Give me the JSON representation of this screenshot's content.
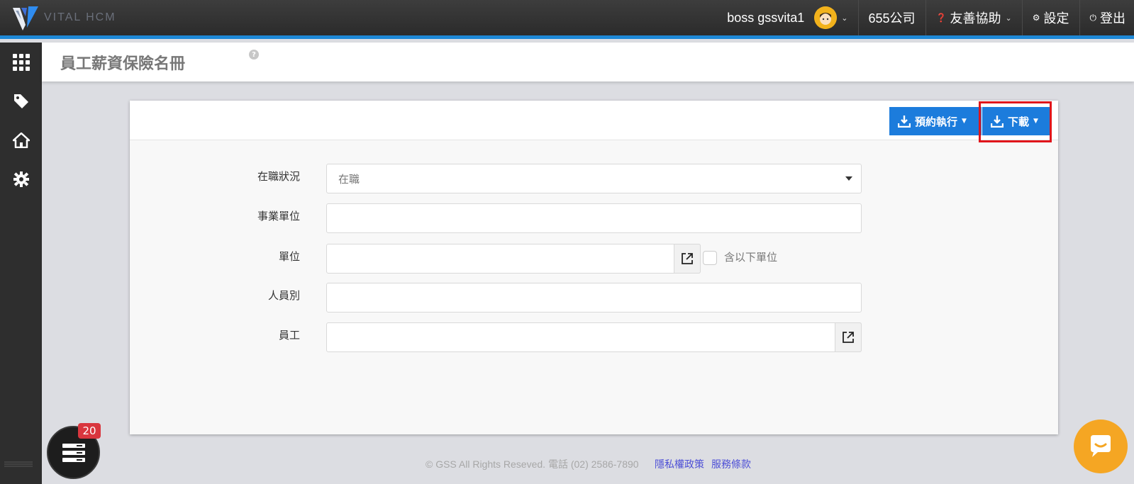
{
  "app": {
    "brand": "VITAL HCM"
  },
  "header": {
    "user_name": "boss gssvita1",
    "company": "655公司",
    "help_label": "友善協助",
    "settings_label": "設定",
    "logout_label": "登出"
  },
  "sidebar": {
    "items": [
      {
        "name": "apps-grid-icon"
      },
      {
        "name": "tag-icon"
      },
      {
        "name": "home-icon"
      },
      {
        "name": "gear-icon"
      }
    ]
  },
  "page": {
    "title": "員工薪資保險名冊",
    "help": "?"
  },
  "toolbar": {
    "schedule_label": "預約執行",
    "download_label": "下載"
  },
  "form": {
    "employment_status": {
      "label": "在職狀況",
      "value": "在職"
    },
    "business_unit": {
      "label": "事業單位",
      "value": ""
    },
    "unit": {
      "label": "單位",
      "value": "",
      "include_sub_label": "含以下單位"
    },
    "staff_type": {
      "label": "人員別",
      "value": ""
    },
    "employee": {
      "label": "員工",
      "value": ""
    }
  },
  "footer": {
    "copyright": "© GSS All Rights Reseved. 電話 (02) 2586-7890",
    "privacy_link": "隱私權政策",
    "terms_link": "服務條款"
  },
  "widgets": {
    "task_badge_count": "20"
  },
  "colors": {
    "accent": "#1e88d6",
    "button": "#1c7cdc",
    "highlight": "#e0151b",
    "chat": "#f5a623"
  }
}
